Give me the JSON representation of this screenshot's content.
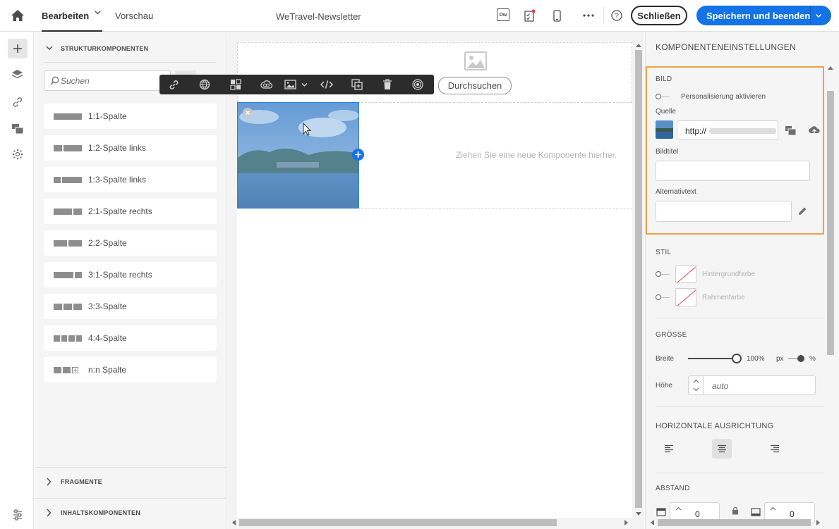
{
  "header": {
    "tabs": [
      {
        "label": "Bearbeiten"
      },
      {
        "label": "Vorschau"
      }
    ],
    "title": "WeTravel-Newsletter",
    "dw_label": "Dw",
    "close_label": "Schließen",
    "save_label": "Speichern und beenden",
    "accent": "#1473e6"
  },
  "left_panel": {
    "section_title": "STRUKTURKOMPONENTEN",
    "search_placeholder": "Suchen",
    "items": [
      {
        "label": "1:1-Spalte"
      },
      {
        "label": "1:2-Spalte links"
      },
      {
        "label": "1:3-Spalte links"
      },
      {
        "label": "2:1-Spalte rechts"
      },
      {
        "label": "2:2-Spalte"
      },
      {
        "label": "3:1-Spalte rechts"
      },
      {
        "label": "3:3-Spalte"
      },
      {
        "label": "4:4-Spalte"
      },
      {
        "label": "n:n Spalte"
      }
    ],
    "fragments": "FRAGMENTE",
    "content_components": "INHALTSKOMPONENTEN"
  },
  "canvas": {
    "browse_label": "Durchsuchen",
    "drop_hint": "Ziehen Sie eine neue Komponente hierher."
  },
  "right_panel": {
    "title": "KOMPONENTENEINSTELLUNGEN",
    "bild": {
      "heading": "BILD",
      "personalize": "Personalisierung aktivieren",
      "source_label": "Quelle",
      "source_value": "http://",
      "image_title_label": "Bildtitel",
      "alt_label": "Alternativtext",
      "highlight": "#f0a04b"
    },
    "stil": {
      "heading": "STIL",
      "bg": "Hintergrundfarbe",
      "border": "Rahmenfarbe"
    },
    "groesse": {
      "heading": "GRÖSSE",
      "width_label": "Breite",
      "width_value": "100%",
      "unit_px": "px",
      "unit_pct": "%",
      "height_label": "Höhe",
      "height_placeholder": "auto",
      "width_slider_fraction": 1.0
    },
    "ausrichtung": {
      "heading": "HORIZONTALE AUSRICHTUNG"
    },
    "abstand": {
      "heading": "ABSTAND",
      "v1": "0",
      "v2": "0"
    }
  }
}
